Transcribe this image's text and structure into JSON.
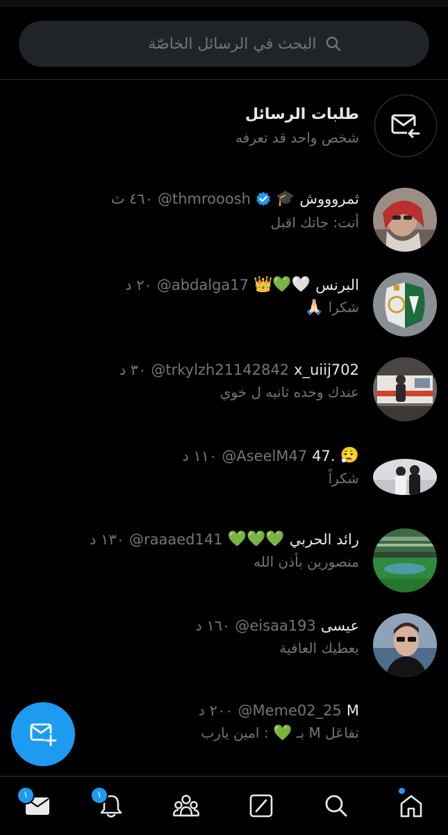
{
  "search": {
    "placeholder": "البحث في الرسائل الخاصّة"
  },
  "requests": {
    "title": "طلبات الرسائل",
    "subtitle": "شخص واحد قد تعرفه"
  },
  "conversations": [
    {
      "name": "ثمروووش",
      "emoji": "🎓",
      "verified": true,
      "handle": "@thmrooosh",
      "time": "٤٦٠ ث",
      "preview": "أنت: جاتك اقبل"
    },
    {
      "name": "البرنس",
      "emoji": "👑💚🤍",
      "handle": "@abdalga17",
      "time": "٢٠ د",
      "preview": "شكرا",
      "preview_emoji": "🙏🏻"
    },
    {
      "name": "x_uiij702",
      "emoji": "",
      "handle": "@trkylzh21142842",
      "time": "٣٠ د",
      "preview": "عندك وحده ثانيه ل خوي"
    },
    {
      "name": "47.",
      "emoji": "😮‍💨",
      "handle": "@AseelM47",
      "time": "١١٠ د",
      "preview": "شكراً"
    },
    {
      "name": "رائد الحربي",
      "emoji": "💚💚💚",
      "handle": "@raaaed141",
      "time": "١٣٠ د",
      "preview": "منصورين بأذن الله"
    },
    {
      "name": "عيسى",
      "emoji": "",
      "handle": "@eisaa193",
      "time": "١٦٠ د",
      "preview": "يعطيك العافية"
    },
    {
      "name": "M",
      "emoji": "",
      "handle": "@Meme02_25",
      "time": "٢٠٠ د",
      "preview": "تفاعَل M بـ",
      "preview_emoji": "💚",
      "preview_tail": ": امين يارب"
    }
  ],
  "nav": {
    "messages_badge": "١",
    "notifications_badge": "١"
  },
  "colors": {
    "accent": "#1d9bf0",
    "background": "#000000",
    "text_primary": "#e7e9ea",
    "text_secondary": "#71767b"
  }
}
